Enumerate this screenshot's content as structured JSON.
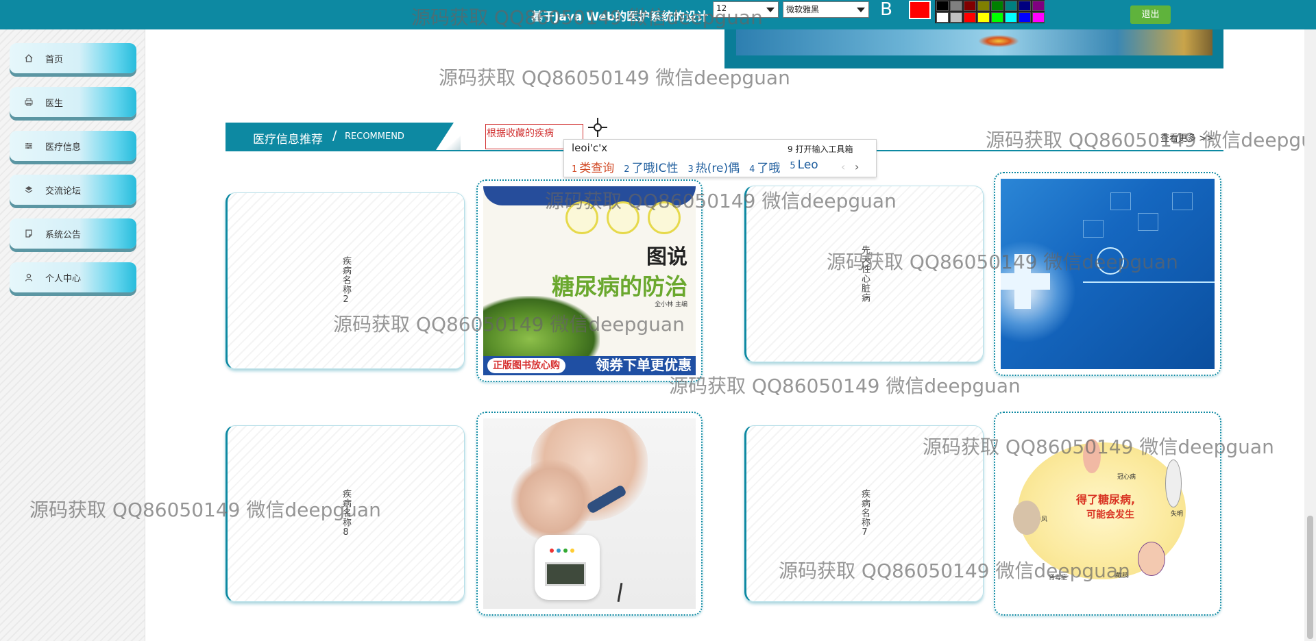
{
  "header": {
    "title": "基于Java Web的医护系统的设计",
    "font_size_value": "12",
    "font_face_value": "微软雅黑",
    "bold_label": "B",
    "current_color": "#ff0000",
    "palette_colors": [
      "#000000",
      "#808080",
      "#800000",
      "#808000",
      "#008000",
      "#008080",
      "#000080",
      "#800080",
      "#ffffff",
      "#c0c0c0",
      "#ff0000",
      "#ffff00",
      "#00ff00",
      "#00ffff",
      "#0000ff",
      "#ff00ff"
    ],
    "logout_label": "退出"
  },
  "sidebar": {
    "items": [
      {
        "label": "首页",
        "icon": "home-icon"
      },
      {
        "label": "医生",
        "icon": "printer-icon"
      },
      {
        "label": "医疗信息",
        "icon": "sliders-icon"
      },
      {
        "label": "交流论坛",
        "icon": "layers-icon"
      },
      {
        "label": "系统公告",
        "icon": "note-icon"
      },
      {
        "label": "个人中心",
        "icon": "user-icon"
      }
    ]
  },
  "section": {
    "title_zh": "医疗信息推荐",
    "separator": "/",
    "title_en": "RECOMMEND",
    "more_label": "查看更多 >>",
    "recommend_input_value": "根据收藏的疾病"
  },
  "ime": {
    "typed": "leoi'c'x",
    "toolbox_label": "9 打开输入工具箱",
    "candidates": [
      {
        "num": "1",
        "text": "类查询"
      },
      {
        "num": "2",
        "text": "了哦IC性"
      },
      {
        "num": "3",
        "text": "热(re)偶"
      },
      {
        "num": "4",
        "text": "了哦"
      },
      {
        "num": "5",
        "text": "Leo"
      }
    ],
    "prev_arrow": "‹",
    "next_arrow": "›"
  },
  "cards": {
    "card1_name": "疾病名称2",
    "card3_name": "先天性心脏病",
    "card5_name": "疾病名称8",
    "card7_name": "疾病名称7",
    "book": {
      "title_1": "图说",
      "title_2": "糖尿病的防治",
      "author": "全小林 主编",
      "promo_left": "正版图书放心购",
      "promo_right": "领券下单更优惠"
    },
    "complications": {
      "headline": "得了糖尿病,",
      "sub": "可能会发生",
      "labels": [
        "冠心病",
        "中风",
        "失明",
        "肾毒症",
        "截肢"
      ]
    }
  },
  "watermark_text": "源码获取 QQ86050149 微信deepguan"
}
